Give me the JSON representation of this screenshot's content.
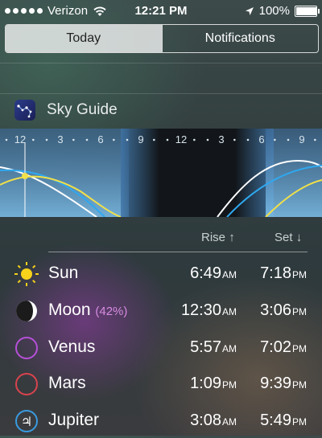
{
  "status_bar": {
    "carrier": "Verizon",
    "time": "12:21 PM",
    "battery": "100%",
    "battery_level": 1.0
  },
  "segments": [
    {
      "label": "Today",
      "active": true
    },
    {
      "label": "Notifications",
      "active": false
    }
  ],
  "widget": {
    "title": "Sky Guide",
    "timeline_labels": [
      "12",
      "3",
      "6",
      "9",
      "12",
      "3",
      "6",
      "9"
    ],
    "rise_label": "Rise",
    "set_label": "Set"
  },
  "bodies": [
    {
      "name": "Sun",
      "extra": "",
      "rise": "6:49",
      "rise_ampm": "AM",
      "set": "7:18",
      "set_ampm": "PM",
      "icon": "sun-icon"
    },
    {
      "name": "Moon",
      "extra": "(42%)",
      "rise": "12:30",
      "rise_ampm": "AM",
      "set": "3:06",
      "set_ampm": "PM",
      "icon": "moon-icon"
    },
    {
      "name": "Venus",
      "extra": "",
      "rise": "5:57",
      "rise_ampm": "AM",
      "set": "7:02",
      "set_ampm": "PM",
      "icon": "venus-icon",
      "color": "#b650d8"
    },
    {
      "name": "Mars",
      "extra": "",
      "rise": "1:09",
      "rise_ampm": "PM",
      "set": "9:39",
      "set_ampm": "PM",
      "icon": "mars-icon",
      "color": "#d8434e"
    },
    {
      "name": "Jupiter",
      "extra": "",
      "rise": "3:08",
      "rise_ampm": "AM",
      "set": "5:49",
      "set_ampm": "PM",
      "icon": "jupiter-icon",
      "color": "#3a9be0"
    }
  ]
}
